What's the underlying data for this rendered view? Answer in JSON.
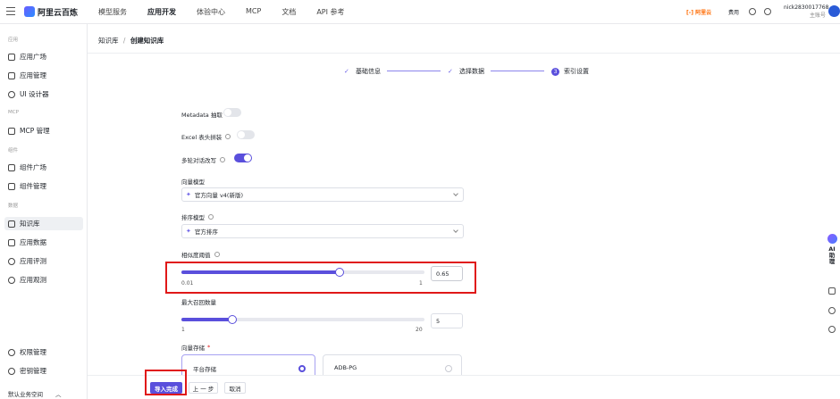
{
  "topbar": {
    "logo": "阿里云百炼",
    "nav": [
      "模型服务",
      "应用开发",
      "体验中心",
      "MCP",
      "文档",
      "API 参考"
    ],
    "active_nav": "应用开发",
    "aliyun_label": "[-] 阿里云",
    "fee": "费用",
    "user_name": "nick2830017768",
    "user_sub": "主账号"
  },
  "sidebar": {
    "sections": [
      "应用",
      "MCP",
      "组件",
      "数据"
    ],
    "items": [
      {
        "label": "应用广场"
      },
      {
        "label": "应用管理"
      },
      {
        "label": "UI 设计器"
      },
      {
        "label": "MCP 管理"
      },
      {
        "label": "组件广场"
      },
      {
        "label": "组件管理"
      },
      {
        "label": "知识库"
      },
      {
        "label": "应用数据"
      },
      {
        "label": "应用评测"
      },
      {
        "label": "应用观测"
      },
      {
        "label": "权限管理"
      },
      {
        "label": "密钥管理"
      }
    ],
    "active_item": "知识库",
    "workspace": "默认业务空间"
  },
  "breadcrumb": {
    "parent": "知识库",
    "sep": "/",
    "current": "创建知识库"
  },
  "steps": [
    {
      "label": "基础信息",
      "state": "done"
    },
    {
      "label": "选择数据",
      "state": "done"
    },
    {
      "label": "索引设置",
      "state": "active",
      "num": "3"
    }
  ],
  "form": {
    "metadata": {
      "label": "Metadata 抽取",
      "on": false
    },
    "excel": {
      "label": "Excel 表头拼装",
      "on": false
    },
    "multi_turn": {
      "label": "多轮对话改写",
      "on": true
    },
    "vector_model": {
      "label": "向量模型",
      "value": "官方向量 v4(新版)"
    },
    "rerank_model": {
      "label": "排序模型",
      "value": "官方排序"
    },
    "similarity": {
      "label": "相似度阈值",
      "min": "0.01",
      "max": "1",
      "value": "0.65",
      "fraction": 0.65
    },
    "max_recall": {
      "label": "最大召回数量",
      "min": "1",
      "max": "20",
      "value": "5",
      "fraction": 0.21
    },
    "vector_store": {
      "label": "向量存储",
      "required": "*",
      "options": [
        {
          "label": "平台存储",
          "selected": true
        },
        {
          "label": "ADB-PG",
          "selected": false
        }
      ]
    }
  },
  "footer": {
    "primary": "导入完成",
    "prev": "上 一 步",
    "cancel": "取消"
  },
  "rightbar": {
    "ai": "AI助理"
  },
  "colors": {
    "accent": "#5a4fdc",
    "highlight": "#e01818"
  }
}
